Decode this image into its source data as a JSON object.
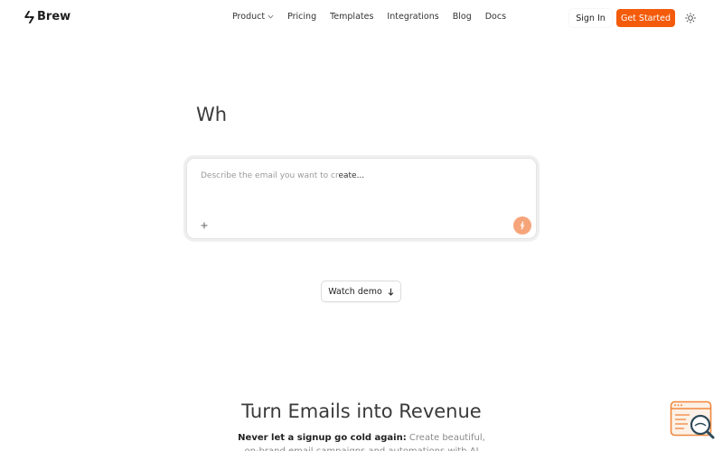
{
  "brand": {
    "name": "Brew",
    "accent_color": "#f45b0a"
  },
  "nav": {
    "items": [
      {
        "label": "Product",
        "has_dropdown": true
      },
      {
        "label": "Pricing"
      },
      {
        "label": "Templates"
      },
      {
        "label": "Integrations"
      },
      {
        "label": "Blog"
      },
      {
        "label": "Docs"
      }
    ]
  },
  "header": {
    "sign_in_label": "Sign In",
    "get_started_label": "Get Started",
    "theme_icon": "sun-icon"
  },
  "hero": {
    "heading": "Wh",
    "prompt_placeholder_dim": "Describe the email you want to cr",
    "prompt_placeholder_dark": "eate...",
    "prompt_placeholder": "Describe the email you want to create...",
    "attach_icon": "plus-icon",
    "submit_icon": "sparkle-icon",
    "watch_demo_label": "Watch demo",
    "watch_demo_icon": "arrow-down-icon"
  },
  "section": {
    "title": "Turn Emails into Revenue",
    "desc_strong": "Never let a signup go cold again:",
    "desc_text": " Create beautiful, on-brand email campaigns and automations with AI"
  },
  "widget": {
    "icon": "browser-search-icon"
  }
}
